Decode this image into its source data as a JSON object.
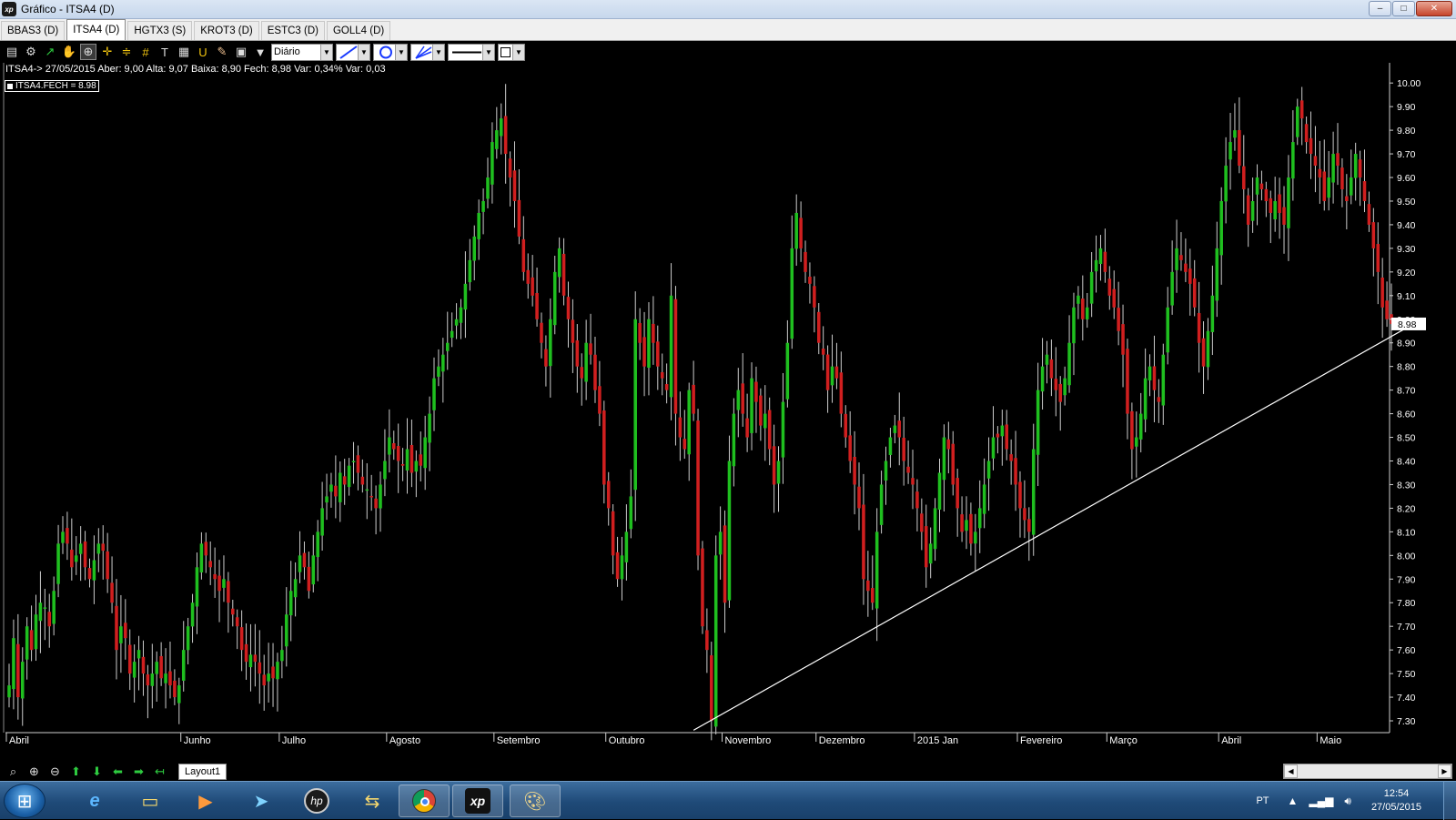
{
  "window": {
    "logo_text": "xp",
    "title": "Gráfico - ITSA4 (D)",
    "controls": [
      "–",
      "□",
      "✕"
    ]
  },
  "tabs": [
    {
      "label": "BBAS3 (D)",
      "active": false
    },
    {
      "label": "ITSA4 (D)",
      "active": true
    },
    {
      "label": "HGTX3 (S)",
      "active": false
    },
    {
      "label": "KROT3 (D)",
      "active": false
    },
    {
      "label": "ESTC3 (D)",
      "active": false
    },
    {
      "label": "GOLL4 (D)",
      "active": false
    }
  ],
  "toolbar": {
    "icons": [
      "chart-type-icon",
      "settings-gear-icon",
      "draw-line-icon",
      "pan-hand-icon",
      "zoom-area-icon",
      "crosshair-icon",
      "hline-icon",
      "grid-icon",
      "text-icon",
      "calculator-icon",
      "magnet-icon",
      "eraser-icon",
      "clipboard-icon",
      "filter-icon"
    ],
    "period": "Diário",
    "line_style_label": "—",
    "accent": "#1a3bff"
  },
  "quote": {
    "text": "ITSA4-> 27/05/2015 Aber: 9,00 Alta: 9,07 Baixa: 8,90 Fech: 8,98 Var: 0,34% Var: 0,03"
  },
  "series_label": "ITSA4.FECH = 8.98",
  "chart_data": {
    "type": "candlestick",
    "symbol": "ITSA4",
    "background": "#000000",
    "up_color": "#1fbf1f",
    "down_color": "#d01f1f",
    "y_range": [
      7.25,
      10.02
    ],
    "y_ticks": [
      "10.00",
      "9.90",
      "9.80",
      "9.70",
      "9.60",
      "9.50",
      "9.40",
      "9.30",
      "9.20",
      "9.10",
      "9.00",
      "8.90",
      "8.80",
      "8.70",
      "8.60",
      "8.50",
      "8.40",
      "8.30",
      "8.20",
      "8.10",
      "8.00",
      "7.90",
      "7.80",
      "7.70",
      "7.60",
      "7.50",
      "7.40",
      "7.30"
    ],
    "last_price": "8.98",
    "x_months": [
      {
        "label": "Abril",
        "index": 0
      },
      {
        "label": "Junho",
        "index": 39
      },
      {
        "label": "Julho",
        "index": 61
      },
      {
        "label": "Agosto",
        "index": 85
      },
      {
        "label": "Setembro",
        "index": 109
      },
      {
        "label": "Outubro",
        "index": 134
      },
      {
        "label": "Novembro",
        "index": 160
      },
      {
        "label": "Dezembro",
        "index": 181
      },
      {
        "label": "2015 Jan",
        "index": 203
      },
      {
        "label": "Fevereiro",
        "index": 226
      },
      {
        "label": "Março",
        "index": 246
      },
      {
        "label": "Abril",
        "index": 271
      },
      {
        "label": "Maio",
        "index": 293
      }
    ],
    "trendline": {
      "from_index": 153,
      "from_value": 7.26,
      "to_index": 313,
      "to_value": 8.97
    },
    "closes": [
      7.45,
      7.65,
      7.4,
      7.55,
      7.7,
      7.6,
      7.75,
      7.8,
      7.78,
      7.7,
      7.85,
      8.05,
      8.1,
      8.05,
      7.95,
      8.0,
      8.05,
      7.95,
      7.9,
      7.98,
      8.05,
      8.02,
      7.9,
      7.8,
      7.6,
      7.7,
      7.65,
      7.5,
      7.55,
      7.6,
      7.5,
      7.45,
      7.5,
      7.55,
      7.48,
      7.5,
      7.45,
      7.4,
      7.45,
      7.6,
      7.7,
      7.8,
      7.95,
      8.05,
      8.0,
      7.95,
      7.9,
      7.85,
      7.9,
      7.8,
      7.75,
      7.7,
      7.6,
      7.55,
      7.58,
      7.55,
      7.5,
      7.45,
      7.5,
      7.48,
      7.55,
      7.6,
      7.75,
      7.85,
      7.9,
      8.0,
      7.95,
      7.85,
      8.0,
      8.1,
      8.2,
      8.25,
      8.3,
      8.25,
      8.35,
      8.3,
      8.38,
      8.4,
      8.35,
      8.3,
      8.28,
      8.25,
      8.2,
      8.3,
      8.4,
      8.5,
      8.45,
      8.4,
      8.38,
      8.45,
      8.35,
      8.4,
      8.38,
      8.5,
      8.6,
      8.75,
      8.8,
      8.85,
      8.9,
      8.95,
      9.0,
      9.05,
      9.15,
      9.25,
      9.35,
      9.45,
      9.5,
      9.6,
      9.75,
      9.8,
      9.85,
      9.7,
      9.6,
      9.5,
      9.35,
      9.2,
      9.15,
      9.1,
      9.0,
      8.9,
      8.8,
      9.0,
      9.2,
      9.3,
      9.1,
      9.0,
      8.9,
      8.8,
      8.75,
      8.9,
      8.85,
      8.7,
      8.6,
      8.3,
      8.2,
      8.0,
      7.9,
      8.0,
      8.1,
      8.25,
      9.0,
      8.9,
      8.8,
      9.0,
      8.9,
      8.8,
      8.75,
      8.7,
      9.1,
      8.6,
      8.5,
      8.45,
      8.7,
      8.6,
      8.0,
      7.7,
      7.6,
      7.3,
      8.0,
      8.1,
      7.8,
      8.4,
      8.6,
      8.7,
      8.6,
      8.5,
      8.75,
      8.65,
      8.55,
      8.6,
      8.45,
      8.3,
      8.4,
      8.65,
      8.9,
      9.3,
      9.45,
      9.3,
      9.2,
      9.15,
      9.05,
      8.9,
      8.85,
      8.7,
      8.8,
      8.75,
      8.6,
      8.5,
      8.4,
      8.3,
      8.2,
      7.9,
      7.85,
      7.8,
      8.1,
      8.3,
      8.4,
      8.5,
      8.55,
      8.5,
      8.4,
      8.35,
      8.3,
      8.2,
      8.1,
      7.95,
      8.05,
      8.2,
      8.35,
      8.5,
      8.45,
      8.3,
      8.2,
      8.1,
      8.15,
      8.05,
      8.1,
      8.2,
      8.3,
      8.4,
      8.5,
      8.5,
      8.55,
      8.45,
      8.4,
      8.3,
      8.2,
      8.15,
      8.1,
      8.45,
      8.7,
      8.8,
      8.85,
      8.75,
      8.7,
      8.65,
      8.75,
      8.9,
      9.05,
      9.1,
      9.0,
      9.05,
      9.2,
      9.25,
      9.3,
      9.2,
      9.1,
      9.05,
      8.95,
      8.85,
      8.6,
      8.45,
      8.5,
      8.6,
      8.75,
      8.8,
      8.7,
      8.65,
      8.85,
      9.05,
      9.2,
      9.3,
      9.25,
      9.2,
      9.15,
      9.05,
      8.9,
      8.8,
      8.95,
      9.1,
      9.3,
      9.5,
      9.65,
      9.75,
      9.8,
      9.65,
      9.55,
      9.4,
      9.5,
      9.6,
      9.55,
      9.5,
      9.45,
      9.5,
      9.45,
      9.4,
      9.6,
      9.75,
      9.9,
      9.85,
      9.75,
      9.7,
      9.65,
      9.6,
      9.5,
      9.6,
      9.7,
      9.65,
      9.55,
      9.5,
      9.6,
      9.7,
      9.6,
      9.5,
      9.4,
      9.3,
      9.2,
      9.05,
      9.0,
      8.98
    ]
  },
  "bottom": {
    "icons": [
      "zoom-icon",
      "zoom-in-icon",
      "zoom-out-icon",
      "arrow-up-icon",
      "arrow-down-icon",
      "arrow-left-icon",
      "arrow-right-icon",
      "arrow-back-icon"
    ],
    "layout_tab": "Layout1",
    "scroll_left": "◀",
    "scroll_right": "▶"
  },
  "taskbar": {
    "apps": [
      "internet-explorer-icon",
      "file-explorer-icon",
      "media-player-icon",
      "send-app-icon",
      "hp-icon",
      "folder-sync-icon",
      "chrome-icon",
      "xp-app-icon",
      "paint-icon"
    ],
    "language": "PT",
    "time": "12:54",
    "date": "27/05/2015"
  }
}
